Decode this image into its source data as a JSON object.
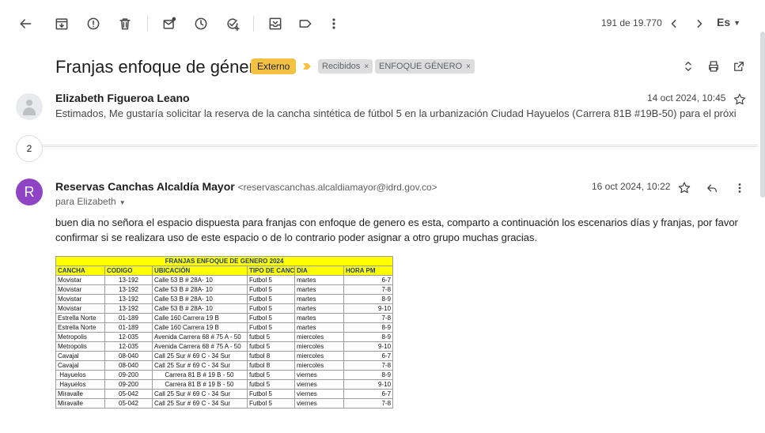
{
  "toolbar": {
    "pager": "191 de 19.770",
    "lang": "Es"
  },
  "subject": {
    "title": "Franjas enfoque de género",
    "chip_external": "Externo",
    "labels": [
      {
        "text": "Recibidos",
        "close": "×"
      },
      {
        "text": "ENFOQUE GÉNERO",
        "close": "×"
      }
    ]
  },
  "thread": {
    "collapsed_count": "2",
    "message1": {
      "sender": "Elizabeth Figueroa Leano",
      "date": "14 oct 2024, 10:45",
      "snippet": "Estimados, Me gustaría solicitar la reserva de la cancha sintética de fútbol 5 en la urbanización Ciudad Hayuelos (Carrera 81B #19B-50) para el próximo viernes,"
    },
    "message2": {
      "avatar_letter": "R",
      "sender": "Reservas Canchas Alcaldía Mayor",
      "email": "<reservascanchas.alcaldiamayor@idrd.gov.co>",
      "to": "para Elizabeth",
      "date": "16 oct 2024, 10:22",
      "body": "buen dia no señora el espacio dispuesta para franjas con enfoque de genero es esta, comparto a continuación los escenarios días y franjas, por favor confirmar si se realizara uso de este espacio o de lo contrario poder asignar a otro grupo muchas gracias."
    }
  },
  "sheet": {
    "title": "FRANJAS ENFOQUE DE GENERO 2024",
    "headers": [
      "CANCHA",
      "CODIGO",
      "UBICACIÓN",
      "TIPO DE CANC",
      "DIA",
      "HORA PM"
    ],
    "rows": [
      [
        "Movistar",
        "13-192",
        "Calle 53 B # 28A- 10",
        "Futbol 5",
        "martes",
        "6-7"
      ],
      [
        "Movistar",
        "13-192",
        "Calle 53 B # 28A- 10",
        "Futbol 5",
        "martes",
        "7-8"
      ],
      [
        "Movistar",
        "13-192",
        "Calle 53 B # 28A- 10",
        "Futbol 5",
        "martes",
        "8-9"
      ],
      [
        "Movistar",
        "13-192",
        "Calle 53 B # 28A- 10",
        "Futbol 5",
        "martes",
        "9-10"
      ],
      [
        "Estrella Norte",
        "01-189",
        "Calle 160 Carrera 19 B",
        "Futbol 5",
        "martes",
        "7-8"
      ],
      [
        "Estrella Norte",
        "01-189",
        "Calle 160 Carrera 19 B",
        "Futbol 5",
        "martes",
        "8-9"
      ],
      [
        "Metropolis",
        "12-035",
        "Avenida Carrera 68 # 75 A - 50",
        "futbol 5",
        "miercoles",
        "8-9"
      ],
      [
        "Metropolis",
        "12-035",
        "Avenida Carrera 68 # 75 A - 50",
        "futbol 5",
        "miercoles",
        "9-10"
      ],
      [
        "Cavajal",
        "08-040",
        "Call 25 Sur # 69 C - 34 Sur",
        "futbol 8",
        "miercoles",
        "6-7"
      ],
      [
        "Cavajal",
        "08-040",
        "Call 25 Sur # 69 C - 34 Sur",
        "futbol 8",
        "miercoles",
        "7-8"
      ],
      [
        " Hayuelos",
        "09-200",
        "      Carrera 81 B # 19 B - 50",
        "futbol 5",
        "viernes",
        "8-9"
      ],
      [
        " Hayuelos",
        "09-200",
        "      Carrera 81 B # 19 B - 50",
        "futbol 5",
        "viernes",
        "9-10"
      ],
      [
        "Miravalle",
        "05-042",
        "Call 25 Sur # 69 C - 34 Sur",
        "Futbol 5",
        "viernes",
        "6-7"
      ],
      [
        "Miravalle",
        "05-042",
        "Call 25 Sur # 69 C - 34 Sur",
        "Futbol 5",
        "viernes",
        "7-8"
      ]
    ]
  }
}
